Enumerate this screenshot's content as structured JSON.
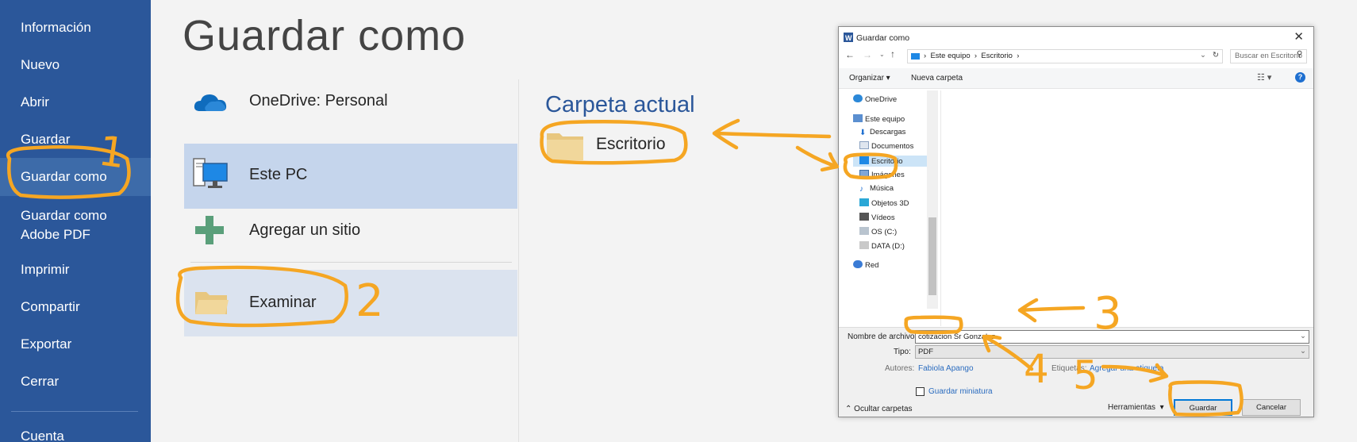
{
  "sidebar": {
    "items": [
      {
        "label": "Información"
      },
      {
        "label": "Nuevo"
      },
      {
        "label": "Abrir"
      },
      {
        "label": "Guardar"
      },
      {
        "label": "Guardar como"
      },
      {
        "label": "Guardar como\nAdobe PDF"
      },
      {
        "label": "Imprimir"
      },
      {
        "label": "Compartir"
      },
      {
        "label": "Exportar"
      },
      {
        "label": "Cerrar"
      },
      {
        "label": "Cuenta"
      }
    ]
  },
  "page": {
    "title": "Guardar como"
  },
  "locations": [
    {
      "label": "OneDrive: Personal",
      "icon": "onedrive-cloud-icon"
    },
    {
      "label": "Este PC",
      "icon": "computer-icon"
    },
    {
      "label": "Agregar un sitio",
      "icon": "plus-icon"
    },
    {
      "label": "Examinar",
      "icon": "folder-icon"
    }
  ],
  "current": {
    "title": "Carpeta actual",
    "folder": "Escritorio"
  },
  "dialog": {
    "title": "Guardar como",
    "path": [
      "Este equipo",
      "Escritorio"
    ],
    "search_placeholder": "Buscar en Escritorio",
    "toolbar": {
      "organize": "Organizar",
      "new_folder": "Nueva carpeta"
    },
    "tree": [
      {
        "label": "OneDrive",
        "icon": "onedrive-icon"
      },
      {
        "label": "Este equipo",
        "icon": "computer-icon"
      },
      {
        "label": "Descargas",
        "icon": "download-icon"
      },
      {
        "label": "Documentos",
        "icon": "documents-icon"
      },
      {
        "label": "Escritorio",
        "icon": "desktop-icon"
      },
      {
        "label": "Imágenes",
        "icon": "pictures-icon"
      },
      {
        "label": "Música",
        "icon": "music-icon"
      },
      {
        "label": "Objetos 3D",
        "icon": "objects-3d-icon"
      },
      {
        "label": "Vídeos",
        "icon": "videos-icon"
      },
      {
        "label": "OS (C:)",
        "icon": "drive-icon"
      },
      {
        "label": "DATA (D:)",
        "icon": "drive-icon"
      },
      {
        "label": "Red",
        "icon": "network-icon"
      }
    ],
    "filename_label": "Nombre de archivo:",
    "filename_value": "cotizacion Sr Gonzalez",
    "type_label": "Tipo:",
    "type_value": "PDF",
    "authors_label": "Autores:",
    "authors_value": "Fabiola Apango",
    "tags_label": "Etiquetas:",
    "tags_value": "Agregar una etiqueta",
    "thumbnail_label": "Guardar miniatura",
    "hide_folders": "Ocultar carpetas",
    "tools": "Herramientas",
    "save": "Guardar",
    "cancel": "Cancelar"
  },
  "annotations": {
    "n1": "1",
    "n2": "2",
    "n3": "3",
    "n4": "4",
    "n5": "5"
  },
  "colors": {
    "brand": "#2b579a",
    "highlight": "#f5a623",
    "selected": "#c5d5ec"
  }
}
